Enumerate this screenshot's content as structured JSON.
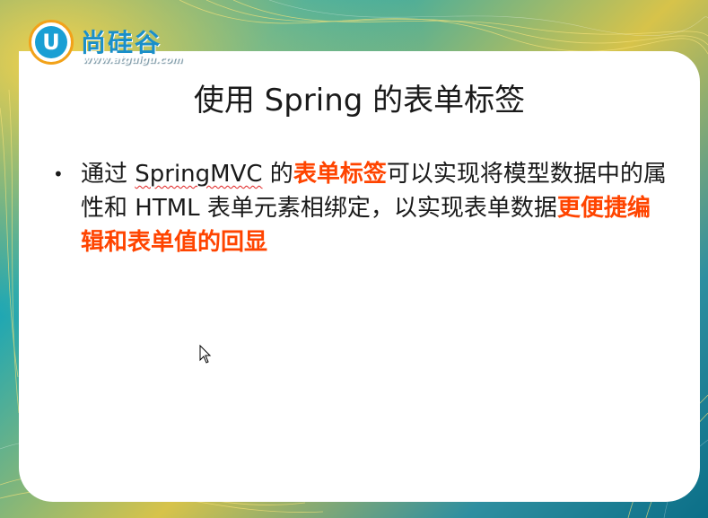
{
  "logo": {
    "letter": "U",
    "name": "尚硅谷",
    "url": "www.atguigu.com"
  },
  "slide": {
    "title": "使用 Spring 的表单标签",
    "bullet": {
      "marker": "•",
      "parts": [
        {
          "text": "通过 ",
          "style": "normal"
        },
        {
          "text": "SpringMVC",
          "style": "squiggle"
        },
        {
          "text": " 的",
          "style": "normal"
        },
        {
          "text": "表单标签",
          "style": "highlight"
        },
        {
          "text": "可以实现将模型数据中的属性和 HTML 表单元素相绑定，以实现表单数据",
          "style": "normal"
        },
        {
          "text": "更便捷编辑和表单值的回显",
          "style": "highlight"
        }
      ]
    }
  },
  "colors": {
    "highlight": "#ff4400",
    "body_text": "#1a1a1a",
    "logo_blue": "#1a8fc9",
    "logo_orange": "#f2a21a",
    "theme_teal": "#1aa6b6"
  },
  "icons": {
    "cursor": "mouse-pointer-icon"
  }
}
